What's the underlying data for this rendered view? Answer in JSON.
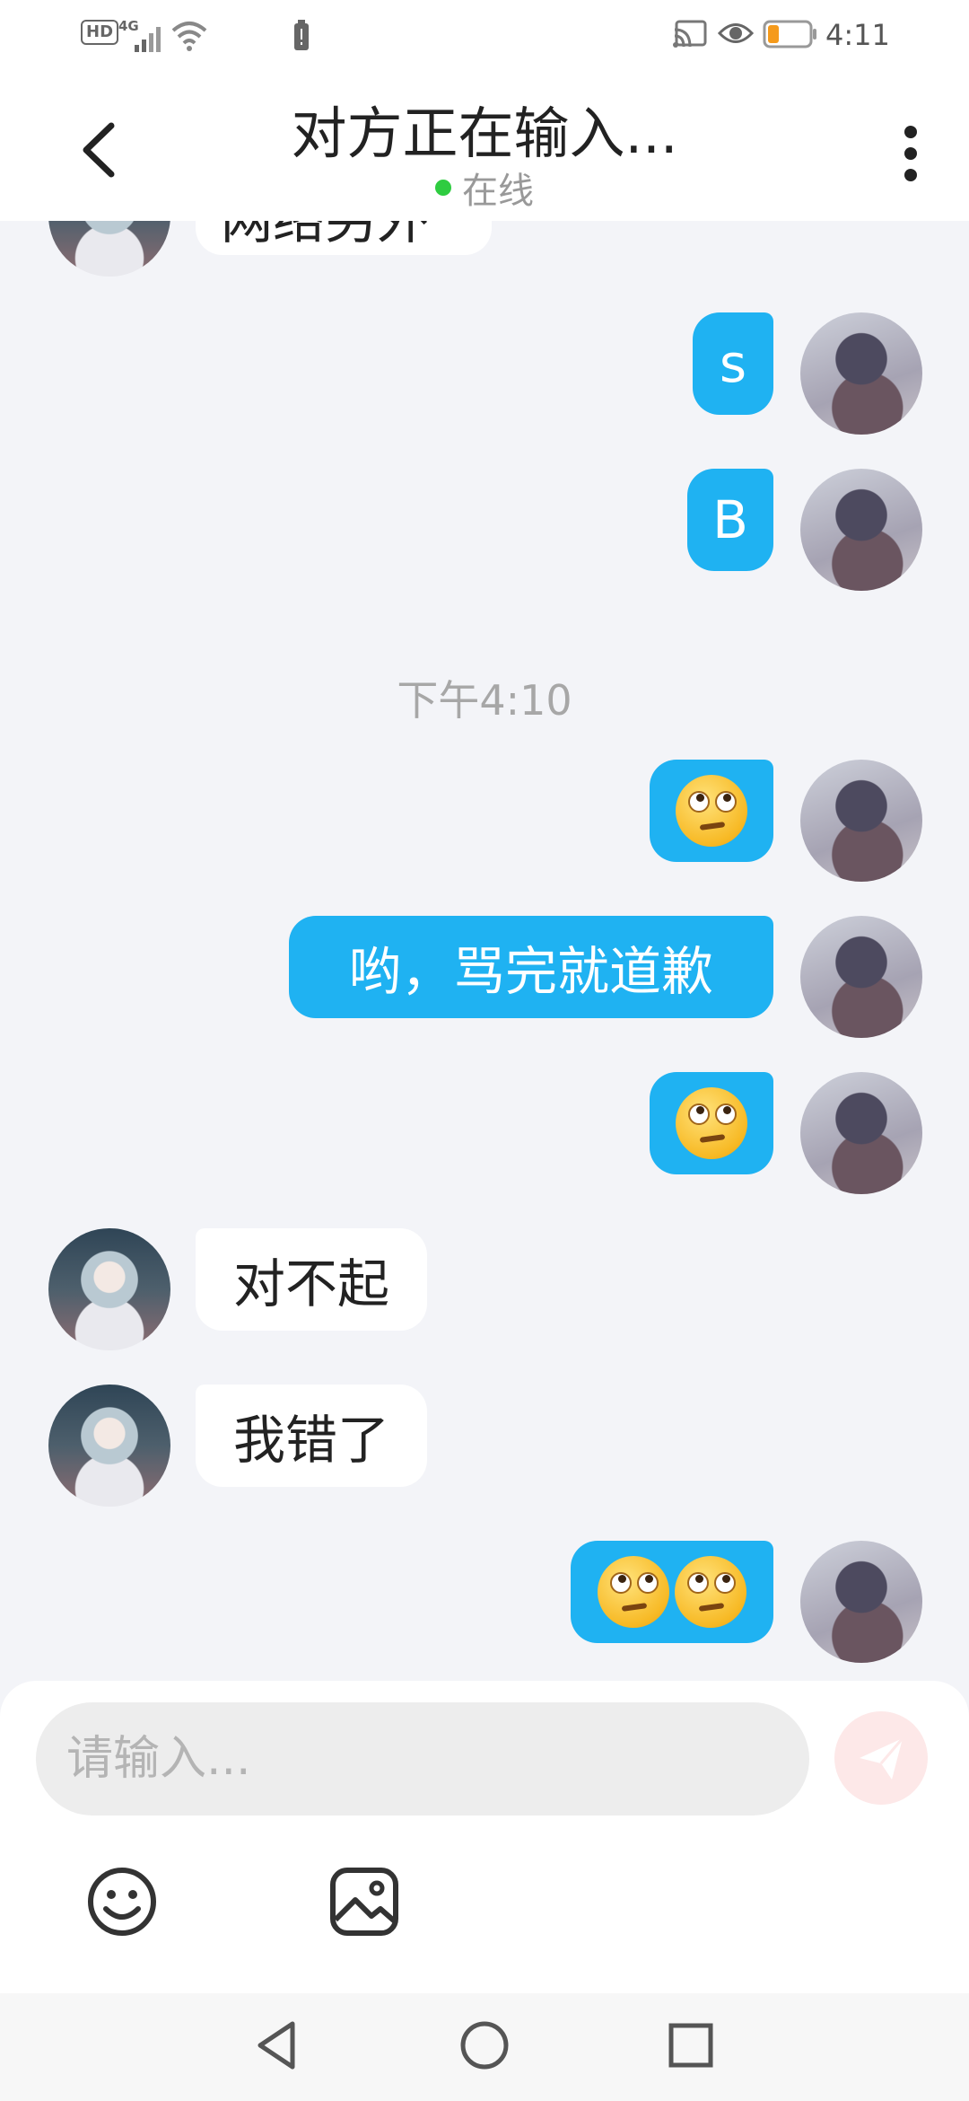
{
  "status_bar": {
    "hd": "HD",
    "network": "4G",
    "time": "4:11",
    "icons": [
      "signal-icon",
      "wifi-icon",
      "battery-saver-icon",
      "cast-icon",
      "eye-icon",
      "battery-icon"
    ]
  },
  "header": {
    "title": "对方正在输入...",
    "status": "在线",
    "status_color": "#2ecc40"
  },
  "partial_message": "网络另外",
  "messages": [
    {
      "from": "me",
      "text": "s"
    },
    {
      "from": "me",
      "text": "B"
    },
    {
      "from": "me",
      "emoji": "face-with-rolling-eyes"
    },
    {
      "from": "me",
      "text": "哟，骂完就道歉"
    },
    {
      "from": "me",
      "emoji": "face-with-rolling-eyes"
    },
    {
      "from": "her",
      "text": "对不起"
    },
    {
      "from": "her",
      "text": "我错了"
    },
    {
      "from": "me",
      "emoji": "face-with-rolling-eyes x2"
    }
  ],
  "timestamp": "下午4:10",
  "input": {
    "placeholder": "请输入...",
    "value": ""
  },
  "colors": {
    "my_bubble": "#1fb2f2",
    "her_bubble": "#ffffff",
    "background": "#f3f4f8",
    "send_button": "#fde8e8"
  }
}
